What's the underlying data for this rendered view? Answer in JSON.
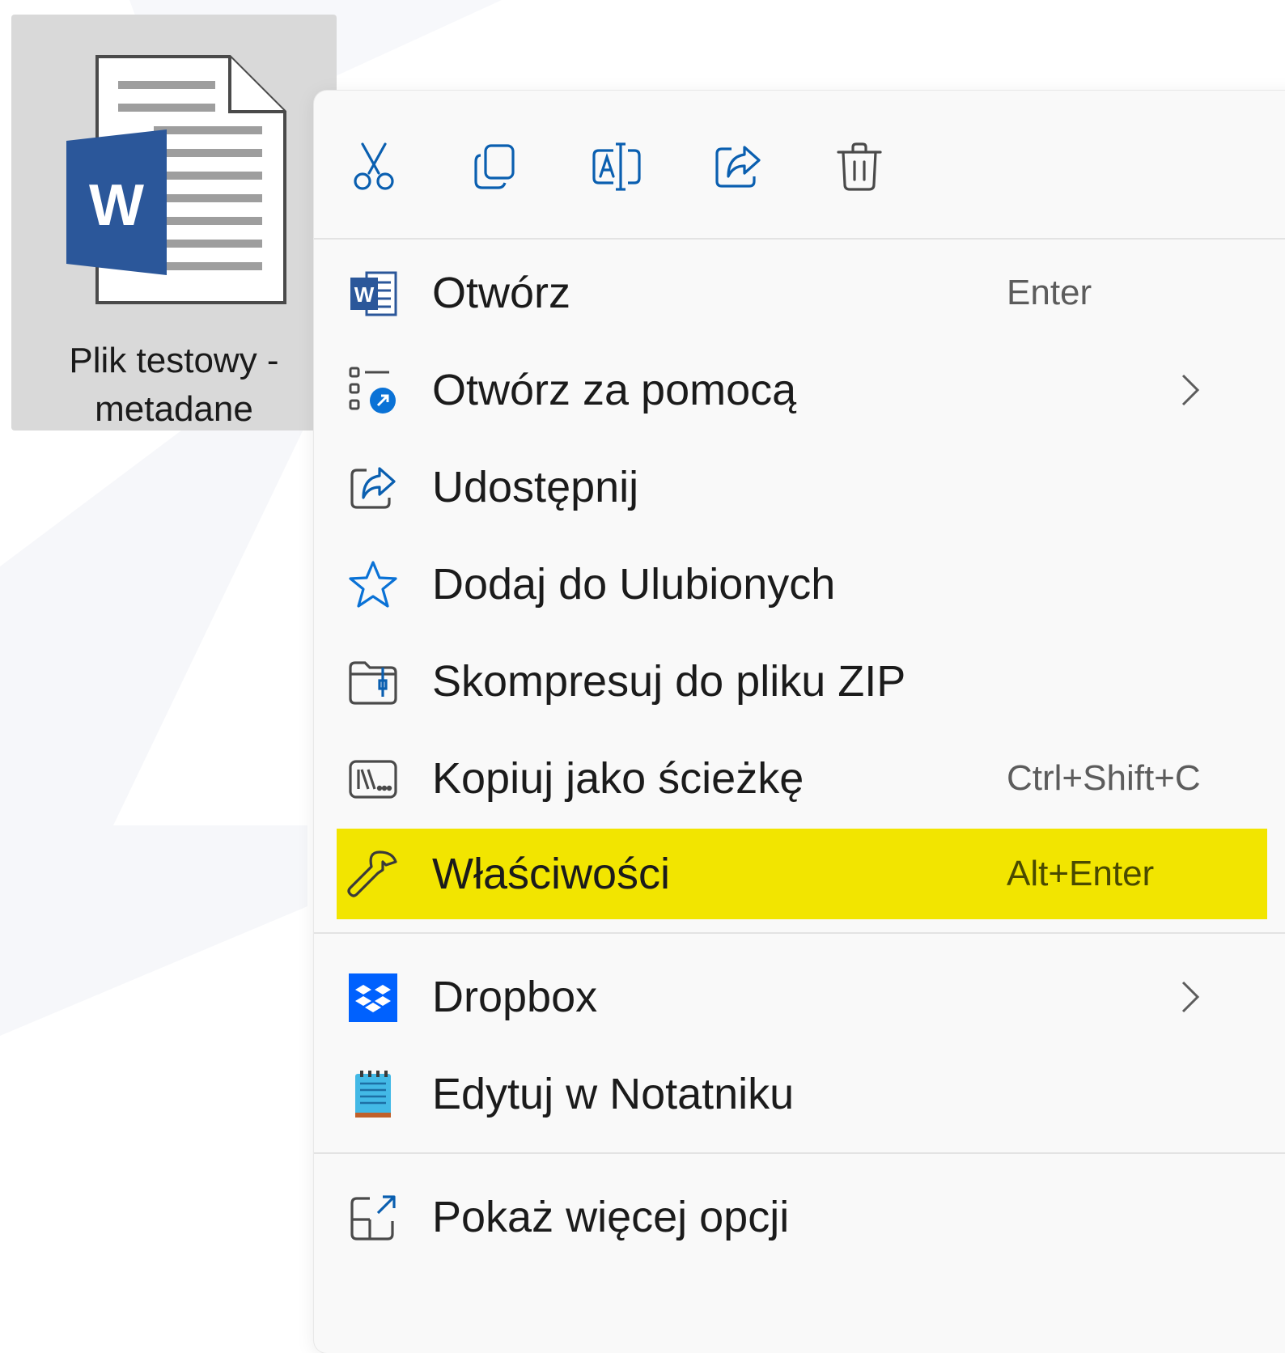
{
  "desktop_file": {
    "icon": "word-document-icon",
    "label_line1": "Plik testowy -",
    "label_line2": "metadane",
    "icon_letter": "W"
  },
  "toolbar": {
    "items": [
      {
        "name": "cut",
        "icon": "scissors-icon"
      },
      {
        "name": "copy",
        "icon": "copy-icon"
      },
      {
        "name": "rename",
        "icon": "rename-icon"
      },
      {
        "name": "share",
        "icon": "share-icon"
      },
      {
        "name": "delete",
        "icon": "trash-icon"
      }
    ]
  },
  "menu": {
    "items": [
      {
        "label": "Otwórz",
        "shortcut": "Enter",
        "icon": "word-icon",
        "submenu": false
      },
      {
        "label": "Otwórz za pomocą",
        "shortcut": "",
        "icon": "open-with-icon",
        "submenu": true
      },
      {
        "label": "Udostępnij",
        "shortcut": "",
        "icon": "share-icon",
        "submenu": false
      },
      {
        "label": "Dodaj do Ulubionych",
        "shortcut": "",
        "icon": "star-icon",
        "submenu": false
      },
      {
        "label": "Skompresuj do pliku ZIP",
        "shortcut": "",
        "icon": "zip-folder-icon",
        "submenu": false
      },
      {
        "label": "Kopiuj jako ścieżkę",
        "shortcut": "Ctrl+Shift+C",
        "icon": "copy-path-icon",
        "submenu": false
      },
      {
        "label": "Właściwości",
        "shortcut": "Alt+Enter",
        "icon": "wrench-icon",
        "submenu": false,
        "highlighted": true
      },
      {
        "label": "Dropbox",
        "shortcut": "",
        "icon": "dropbox-icon",
        "submenu": true
      },
      {
        "label": "Edytuj w Notatniku",
        "shortcut": "",
        "icon": "notepad-icon",
        "submenu": false
      },
      {
        "label": "Pokaż więcej opcji",
        "shortcut": "",
        "icon": "show-more-icon",
        "submenu": false
      }
    ]
  },
  "colors": {
    "accent_blue": "#0078d4",
    "word_blue": "#2b579a",
    "highlight_yellow": "#f2e500",
    "menu_background": "#f9f9f9",
    "dropbox_blue": "#0061fe"
  }
}
